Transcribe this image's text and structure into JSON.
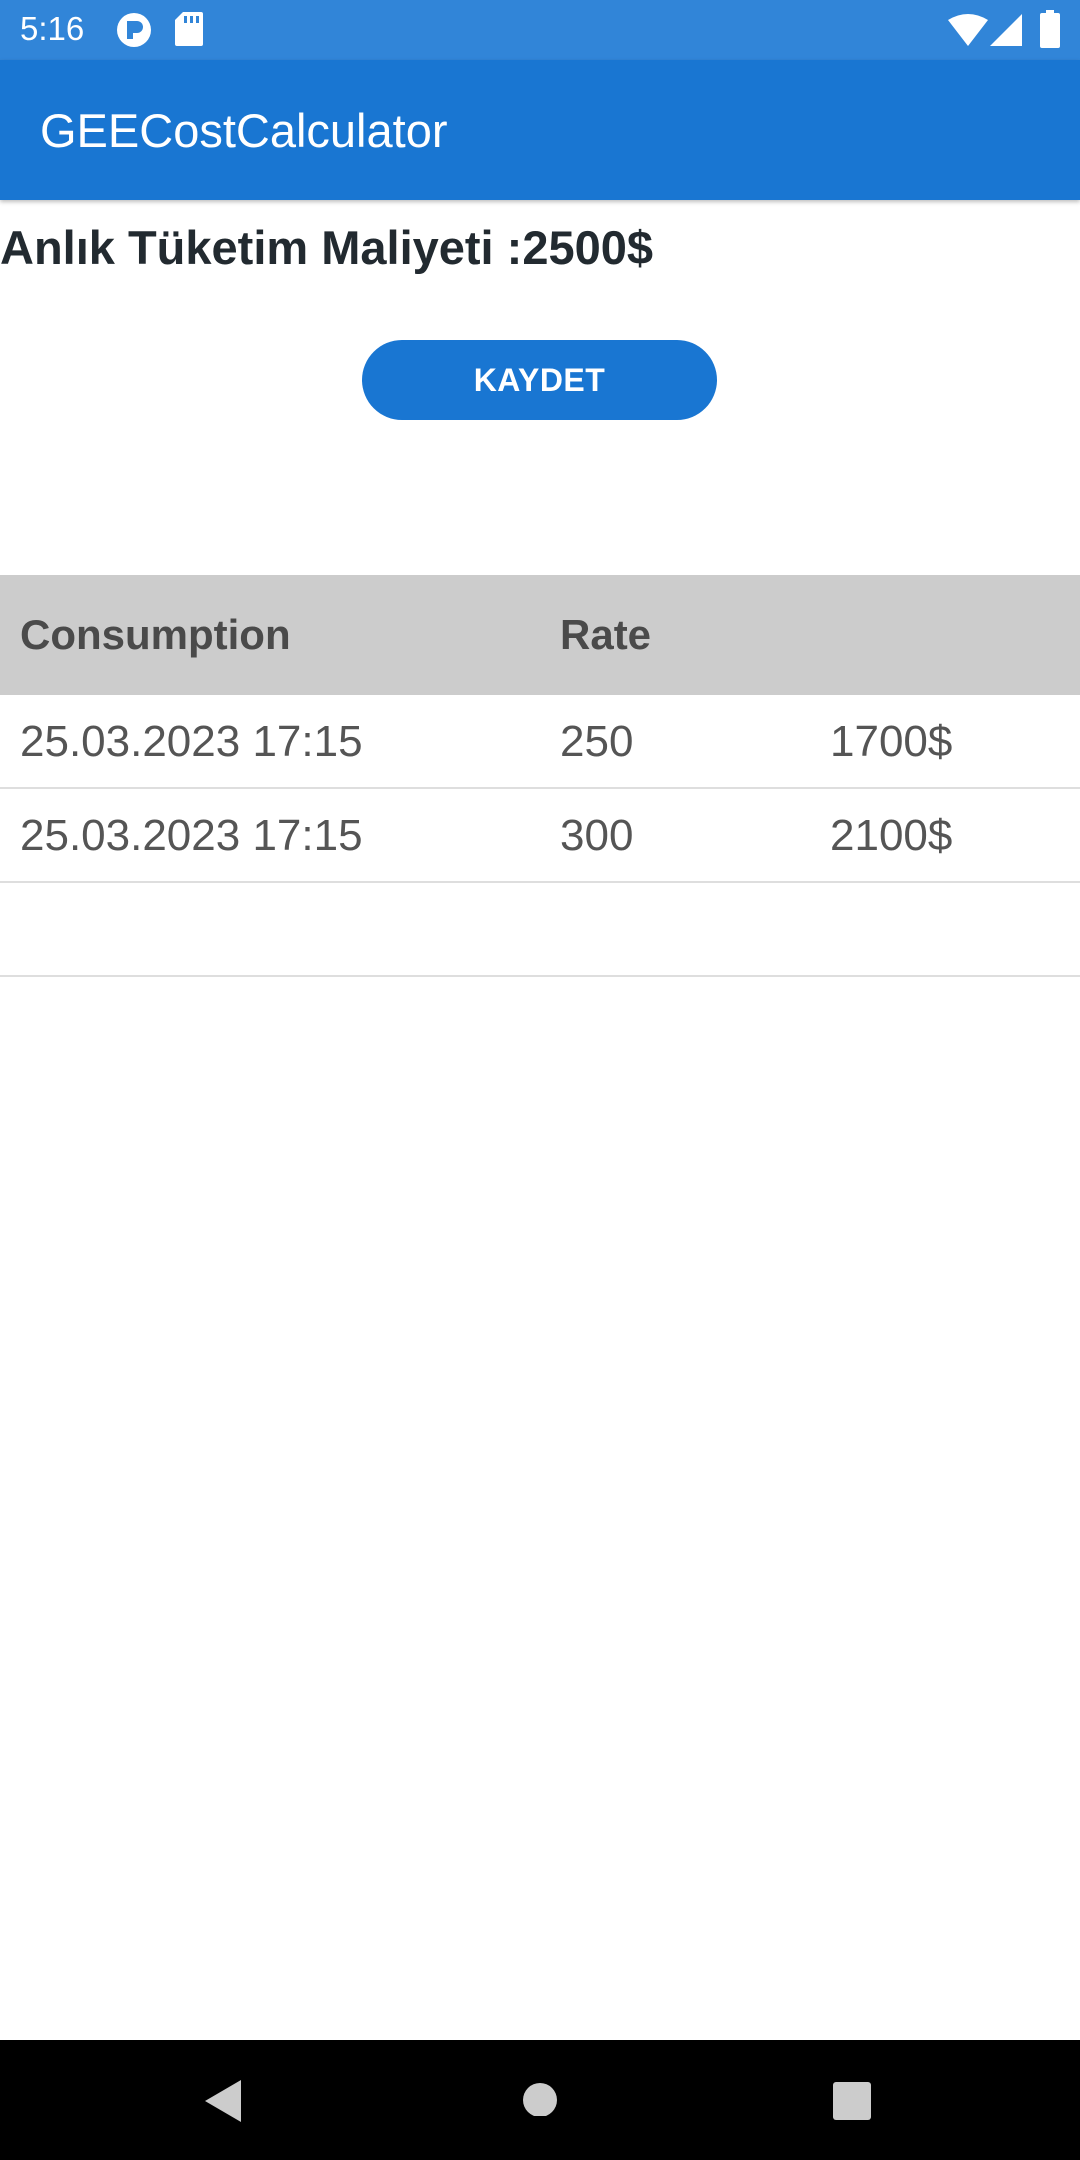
{
  "status_bar": {
    "time": "5:16",
    "left_icons": [
      "pocket-app-icon",
      "sd-card-icon"
    ],
    "right_icons": [
      "wifi-icon",
      "cell-signal-icon",
      "battery-icon"
    ]
  },
  "app_bar": {
    "title": "GEECostCalculator"
  },
  "main": {
    "cost_text": "Anlık Tüketim Maliyeti :2500$",
    "save_label": "KAYDET"
  },
  "table": {
    "headers": [
      "Consumption",
      "Rate",
      ""
    ],
    "rows": [
      [
        "25.03.2023 17:15",
        "250",
        "1700$"
      ],
      [
        "25.03.2023 17:15",
        "300",
        "2100$"
      ]
    ]
  },
  "nav_bar": {
    "icons": [
      "back-icon",
      "home-icon",
      "recents-icon"
    ]
  },
  "colors": {
    "primary": "#1976d2",
    "status_bar": "#3185d8",
    "header_bg": "#cccccc"
  }
}
